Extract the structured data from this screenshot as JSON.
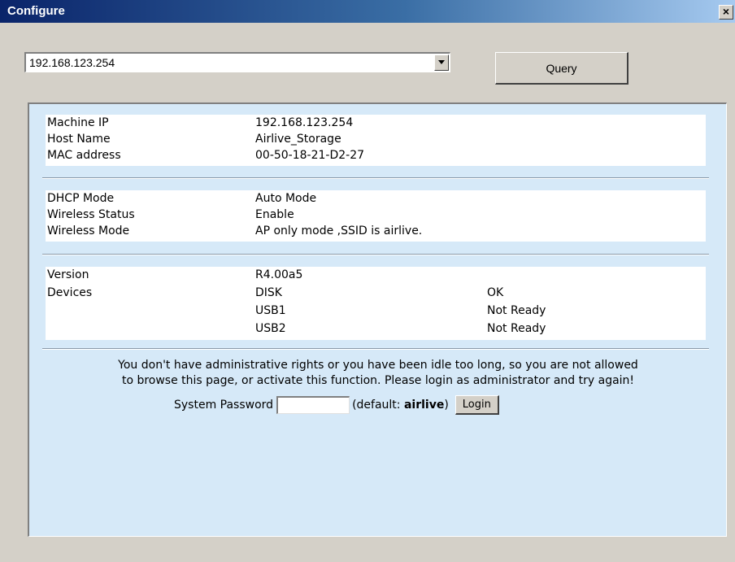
{
  "window": {
    "title": "Configure",
    "close_glyph": "×"
  },
  "toolbar": {
    "ip_select_value": "192.168.123.254",
    "query_label": "Query"
  },
  "info": {
    "network": [
      {
        "label": "Machine IP",
        "value": "192.168.123.254"
      },
      {
        "label": "Host Name",
        "value": "Airlive_Storage"
      },
      {
        "label": "MAC address",
        "value": "00-50-18-21-D2-27"
      }
    ],
    "wireless": [
      {
        "label": "DHCP Mode",
        "value": "Auto Mode"
      },
      {
        "label": "Wireless Status",
        "value": "Enable"
      },
      {
        "label": "Wireless Mode",
        "value": "AP only mode ,SSID is airlive."
      }
    ],
    "version_label": "Version",
    "version_value": "R4.00a5",
    "devices_label": "Devices",
    "devices": [
      {
        "name": "DISK",
        "status": "OK"
      },
      {
        "name": "USB1",
        "status": "Not Ready"
      },
      {
        "name": "USB2",
        "status": "Not Ready"
      }
    ]
  },
  "auth": {
    "message_line1": "You don't have administrative rights or you have been idle too long, so you are not allowed",
    "message_line2": "to browse this page, or activate this function. Please login as administrator and try again!",
    "password_label": "System Password",
    "password_value": "",
    "default_hint_prefix": "(default: ",
    "default_hint_value": "airlive",
    "default_hint_suffix": ")",
    "login_label": "Login"
  },
  "colors": {
    "window_bg": "#d4d0c8",
    "panel_bg": "#d6e9f8",
    "titlebar_start": "#0a246a",
    "titlebar_end": "#a6caf0"
  },
  "icons": {
    "combo_arrow": "chevron-down-icon",
    "close": "close-icon"
  }
}
